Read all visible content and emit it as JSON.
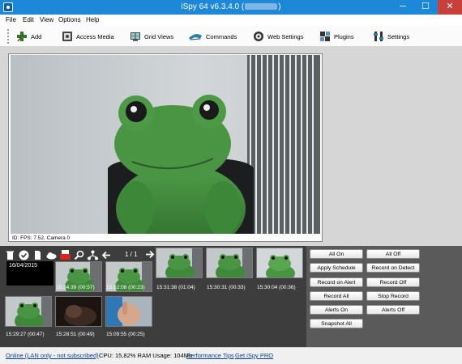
{
  "window": {
    "title": "iSpy 64 v6.3.4.0 (",
    "title_suffix": ")",
    "minimize": "─",
    "maximize": "☐",
    "close": "✕"
  },
  "menu": [
    "File",
    "Edit",
    "View",
    "Options",
    "Help"
  ],
  "toolbar": {
    "add": "Add",
    "access_media": "Access Media",
    "grid_views": "Grid Views",
    "commands": "Commands",
    "web_settings": "Web Settings",
    "plugins": "Plugins",
    "settings": "Settings"
  },
  "camera": {
    "caption": "ID: FPS: 7.52, Camera 0"
  },
  "media_bar": {
    "page_indicator": "1 / 1",
    "date": "16/04/2015"
  },
  "thumbnails": [
    {
      "label": "15:34:39 (00:57)",
      "kind": "frog"
    },
    {
      "label": "15:32:08 (00:23)",
      "kind": "frog"
    },
    {
      "label": "15:31:38 (01:04)",
      "kind": "frog"
    },
    {
      "label": "15:30:31 (00:33)",
      "kind": "frog"
    },
    {
      "label": "15:30:04 (00:36)",
      "kind": "frog-light"
    },
    {
      "label": "15:29:27 (00:47)",
      "kind": "frog"
    },
    {
      "label": "15:28:51 (00:49)",
      "kind": "dark"
    },
    {
      "label": "15:09:55 (00:25)",
      "kind": "hand"
    }
  ],
  "controls": {
    "all_on": "All On",
    "all_off": "All Off",
    "apply_schedule": "Apply Schedule",
    "record_on_detect": "Record on Detect",
    "record_on_alert": "Record on Alert",
    "record_off": "Record Off",
    "record_all": "Record All",
    "stop_record": "Stop Record",
    "alerts_on": "Alerts On",
    "alerts_off": "Alerts Off",
    "snapshot_all": "Snapshot All"
  },
  "status": {
    "online": "Online (LAN only - not subscribed)",
    "cpu": "CPU: 15,82% RAM Usage: 104Mb",
    "perf_tips": "Performance Tips",
    "get_pro": "Get iSpy PRO"
  },
  "colors": {
    "titlebar": "#1e88d8",
    "close_button": "#c7413a",
    "frog_green": "#3f8a3a",
    "panel_dark": "#3d3d3d"
  }
}
